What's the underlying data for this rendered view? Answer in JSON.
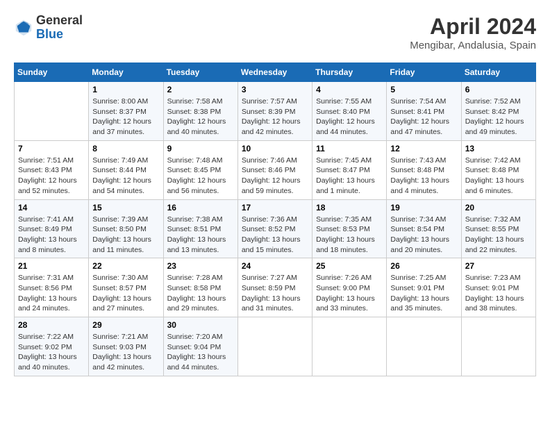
{
  "header": {
    "logo_general": "General",
    "logo_blue": "Blue",
    "month_year": "April 2024",
    "location": "Mengibar, Andalusia, Spain"
  },
  "weekdays": [
    "Sunday",
    "Monday",
    "Tuesday",
    "Wednesday",
    "Thursday",
    "Friday",
    "Saturday"
  ],
  "weeks": [
    [
      {
        "day": "",
        "info": ""
      },
      {
        "day": "1",
        "info": "Sunrise: 8:00 AM\nSunset: 8:37 PM\nDaylight: 12 hours\nand 37 minutes."
      },
      {
        "day": "2",
        "info": "Sunrise: 7:58 AM\nSunset: 8:38 PM\nDaylight: 12 hours\nand 40 minutes."
      },
      {
        "day": "3",
        "info": "Sunrise: 7:57 AM\nSunset: 8:39 PM\nDaylight: 12 hours\nand 42 minutes."
      },
      {
        "day": "4",
        "info": "Sunrise: 7:55 AM\nSunset: 8:40 PM\nDaylight: 12 hours\nand 44 minutes."
      },
      {
        "day": "5",
        "info": "Sunrise: 7:54 AM\nSunset: 8:41 PM\nDaylight: 12 hours\nand 47 minutes."
      },
      {
        "day": "6",
        "info": "Sunrise: 7:52 AM\nSunset: 8:42 PM\nDaylight: 12 hours\nand 49 minutes."
      }
    ],
    [
      {
        "day": "7",
        "info": "Sunrise: 7:51 AM\nSunset: 8:43 PM\nDaylight: 12 hours\nand 52 minutes."
      },
      {
        "day": "8",
        "info": "Sunrise: 7:49 AM\nSunset: 8:44 PM\nDaylight: 12 hours\nand 54 minutes."
      },
      {
        "day": "9",
        "info": "Sunrise: 7:48 AM\nSunset: 8:45 PM\nDaylight: 12 hours\nand 56 minutes."
      },
      {
        "day": "10",
        "info": "Sunrise: 7:46 AM\nSunset: 8:46 PM\nDaylight: 12 hours\nand 59 minutes."
      },
      {
        "day": "11",
        "info": "Sunrise: 7:45 AM\nSunset: 8:47 PM\nDaylight: 13 hours\nand 1 minute."
      },
      {
        "day": "12",
        "info": "Sunrise: 7:43 AM\nSunset: 8:48 PM\nDaylight: 13 hours\nand 4 minutes."
      },
      {
        "day": "13",
        "info": "Sunrise: 7:42 AM\nSunset: 8:48 PM\nDaylight: 13 hours\nand 6 minutes."
      }
    ],
    [
      {
        "day": "14",
        "info": "Sunrise: 7:41 AM\nSunset: 8:49 PM\nDaylight: 13 hours\nand 8 minutes."
      },
      {
        "day": "15",
        "info": "Sunrise: 7:39 AM\nSunset: 8:50 PM\nDaylight: 13 hours\nand 11 minutes."
      },
      {
        "day": "16",
        "info": "Sunrise: 7:38 AM\nSunset: 8:51 PM\nDaylight: 13 hours\nand 13 minutes."
      },
      {
        "day": "17",
        "info": "Sunrise: 7:36 AM\nSunset: 8:52 PM\nDaylight: 13 hours\nand 15 minutes."
      },
      {
        "day": "18",
        "info": "Sunrise: 7:35 AM\nSunset: 8:53 PM\nDaylight: 13 hours\nand 18 minutes."
      },
      {
        "day": "19",
        "info": "Sunrise: 7:34 AM\nSunset: 8:54 PM\nDaylight: 13 hours\nand 20 minutes."
      },
      {
        "day": "20",
        "info": "Sunrise: 7:32 AM\nSunset: 8:55 PM\nDaylight: 13 hours\nand 22 minutes."
      }
    ],
    [
      {
        "day": "21",
        "info": "Sunrise: 7:31 AM\nSunset: 8:56 PM\nDaylight: 13 hours\nand 24 minutes."
      },
      {
        "day": "22",
        "info": "Sunrise: 7:30 AM\nSunset: 8:57 PM\nDaylight: 13 hours\nand 27 minutes."
      },
      {
        "day": "23",
        "info": "Sunrise: 7:28 AM\nSunset: 8:58 PM\nDaylight: 13 hours\nand 29 minutes."
      },
      {
        "day": "24",
        "info": "Sunrise: 7:27 AM\nSunset: 8:59 PM\nDaylight: 13 hours\nand 31 minutes."
      },
      {
        "day": "25",
        "info": "Sunrise: 7:26 AM\nSunset: 9:00 PM\nDaylight: 13 hours\nand 33 minutes."
      },
      {
        "day": "26",
        "info": "Sunrise: 7:25 AM\nSunset: 9:01 PM\nDaylight: 13 hours\nand 35 minutes."
      },
      {
        "day": "27",
        "info": "Sunrise: 7:23 AM\nSunset: 9:01 PM\nDaylight: 13 hours\nand 38 minutes."
      }
    ],
    [
      {
        "day": "28",
        "info": "Sunrise: 7:22 AM\nSunset: 9:02 PM\nDaylight: 13 hours\nand 40 minutes."
      },
      {
        "day": "29",
        "info": "Sunrise: 7:21 AM\nSunset: 9:03 PM\nDaylight: 13 hours\nand 42 minutes."
      },
      {
        "day": "30",
        "info": "Sunrise: 7:20 AM\nSunset: 9:04 PM\nDaylight: 13 hours\nand 44 minutes."
      },
      {
        "day": "",
        "info": ""
      },
      {
        "day": "",
        "info": ""
      },
      {
        "day": "",
        "info": ""
      },
      {
        "day": "",
        "info": ""
      }
    ]
  ]
}
